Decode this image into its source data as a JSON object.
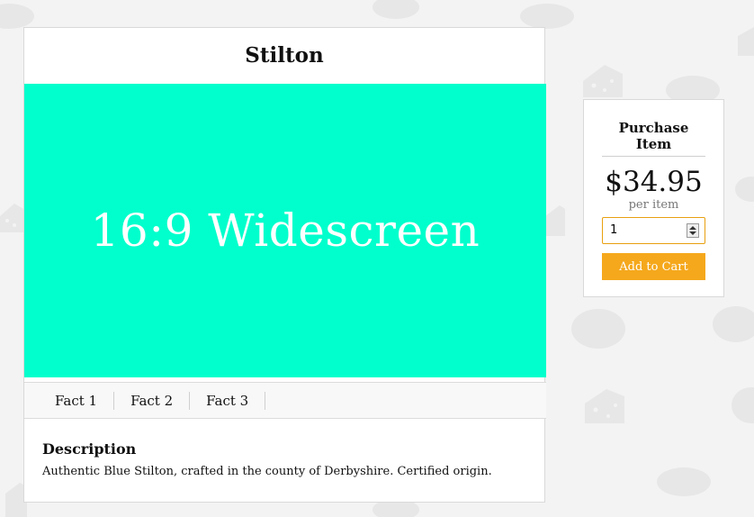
{
  "product": {
    "title": "Stilton",
    "hero_label": "16:9 Widescreen",
    "hero_color": "#00ffcc",
    "facts": [
      "Fact 1",
      "Fact 2",
      "Fact 3"
    ],
    "description_heading": "Description",
    "description_text": "Authentic Blue Stilton, crafted in the county of Derbyshire. Certified origin."
  },
  "purchase": {
    "heading": "Purchase Item",
    "price": "$34.95",
    "price_unit": "per item",
    "quantity": "1",
    "add_to_cart_label": "Add to Cart",
    "button_color": "#f5a81c",
    "focus_border_color": "#e8a010"
  },
  "background": {
    "color": "#f3f3f3",
    "pattern_icons": [
      "cheese-wedge-icon",
      "cheese-wheel-icon"
    ]
  }
}
